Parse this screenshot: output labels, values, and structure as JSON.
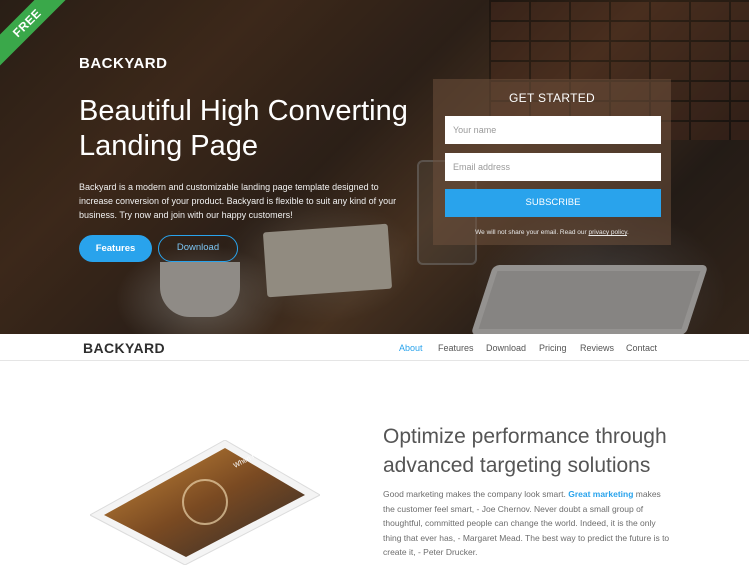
{
  "ribbon": "FREE",
  "hero": {
    "logo": "BACKYARD",
    "title": "Beautiful High Converting Landing Page",
    "lead": "Backyard is a modern and customizable landing page template designed to increase conversion of your product. Backyard is flexible to suit any kind of your business. Try now and join with our happy customers!",
    "btn_features": "Features",
    "btn_download": "Download"
  },
  "form": {
    "title": "GET STARTED",
    "name_placeholder": "Your name",
    "email_placeholder": "Email address",
    "submit": "SUBSCRIBE",
    "note_prefix": "We will not share your email. Read our ",
    "note_link": "privacy policy",
    "note_suffix": "."
  },
  "nav": {
    "logo": "BACKYARD",
    "items": [
      "About",
      "Features",
      "Download",
      "Pricing",
      "Reviews",
      "Contact"
    ],
    "active": "About"
  },
  "about": {
    "title": "Optimize performance through advanced targeting solutions",
    "text_1": "Good marketing makes the company look smart. ",
    "text_highlight": "Great marketing",
    "text_2": " makes the customer feel smart, - Joe Chernov. Never doubt a small group of thoughtful, committed people can change the world. Indeed, it is the only thing that ever has, - Margaret Mead. The best way to predict the future is to create it, - Peter Drucker.",
    "device_caption": "When I See You"
  },
  "colors": {
    "accent": "#29a3ec",
    "ribbon": "#3aa84a"
  }
}
